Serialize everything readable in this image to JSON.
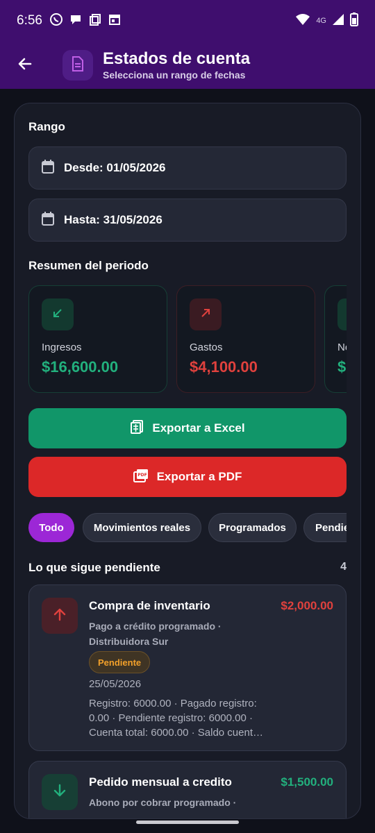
{
  "status_bar": {
    "time": "6:56",
    "network": "4G"
  },
  "header": {
    "title": "Estados de cuenta",
    "subtitle": "Selecciona un rango de fechas"
  },
  "range": {
    "label": "Rango",
    "from": "Desde: 01/05/2026",
    "to": "Hasta: 31/05/2026"
  },
  "summary": {
    "label": "Resumen del periodo",
    "cards": [
      {
        "label": "Ingresos",
        "amount": "$16,600.00",
        "color": "#22b07d"
      },
      {
        "label": "Gastos",
        "amount": "$4,100.00",
        "color": "#e0413d"
      },
      {
        "label": "Ne",
        "amount": "$",
        "color": "#22b07d"
      }
    ]
  },
  "export": {
    "excel_label": "Exportar a Excel",
    "pdf_label": "Exportar a PDF"
  },
  "filters": [
    "Todo",
    "Movimientos reales",
    "Programados",
    "Pendie"
  ],
  "pending": {
    "label": "Lo que sigue pendiente",
    "count": "4",
    "items": [
      {
        "title": "Compra de inventario",
        "amount": "$2,000.00",
        "desc": "Pago a crédito programado · Distribuidora Sur",
        "badge": "Pendiente",
        "date": "25/05/2026",
        "detail": "Registro: 6000.00 · Pagado registro: 0.00 · Pendiente registro: 6000.00 · Cuenta total: 6000.00 · Saldo cuent…"
      },
      {
        "title": "Pedido mensual a credito",
        "amount": "$1,500.00",
        "desc": "Abono por cobrar programado ·"
      }
    ]
  },
  "colors": {
    "accent": "#9c27d6",
    "income": "#22b07d",
    "expense": "#e0413d",
    "excel": "#119669",
    "pdf": "#dc2828"
  }
}
